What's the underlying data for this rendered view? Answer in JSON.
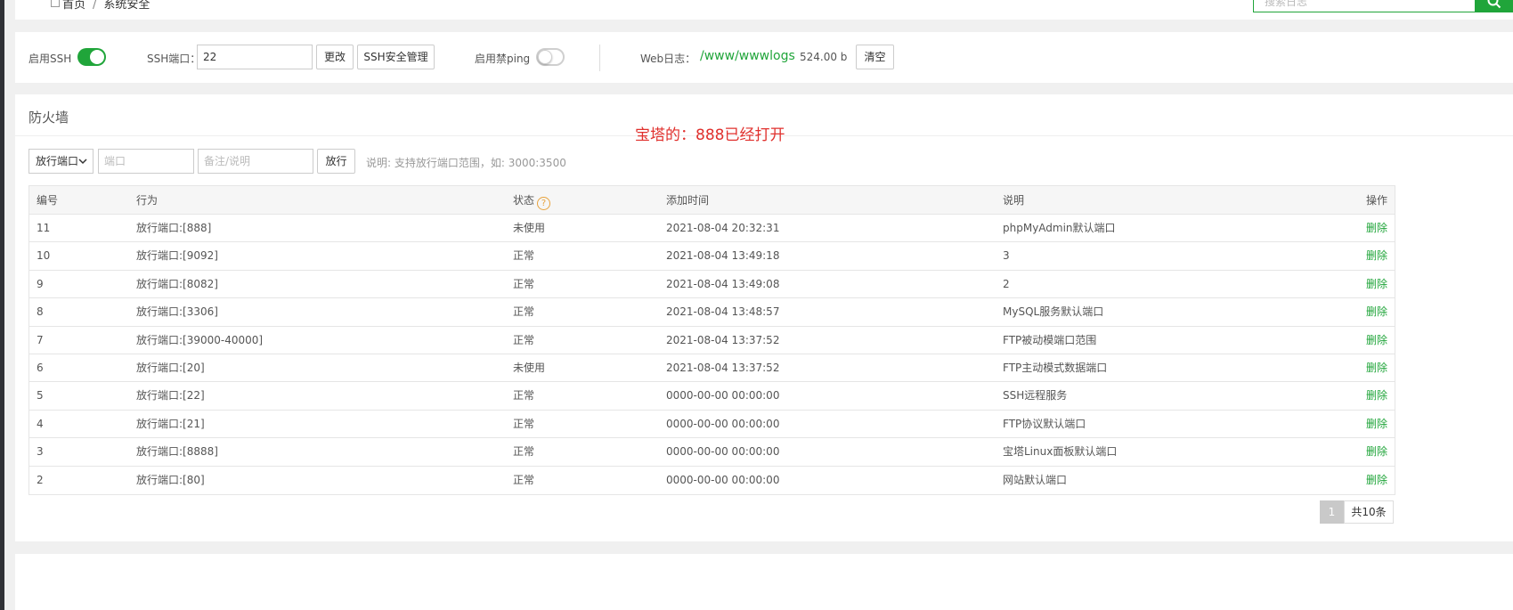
{
  "breadcrumb": {
    "home": "首页",
    "separator": "/",
    "current": "系统安全"
  },
  "search": {
    "placeholder": "搜索日志"
  },
  "ssh": {
    "enable_label": "启用SSH",
    "enabled": true,
    "port_label": "SSH端口：",
    "port_value": "22",
    "change_button": "更改",
    "manage_button": "SSH安全管理",
    "ping_label": "启用禁ping",
    "ping_enabled": false,
    "weblog_label": "Web日志：",
    "weblog_path": "/www/wwwlogs",
    "weblog_size": "524.00 b",
    "clear_button": "清空"
  },
  "firewall": {
    "title": "防火墙",
    "annotation": "宝塔的：888已经打开",
    "action_select": "放行端口",
    "port_placeholder": "端口",
    "remark_placeholder": "备注/说明",
    "add_button": "放行",
    "note": "说明: 支持放行端口范围，如: 3000:3500",
    "columns": [
      "编号",
      "行为",
      "状态",
      "添加时间",
      "说明",
      "操作"
    ],
    "rows": [
      {
        "id": "11",
        "action": "放行端口:[888]",
        "status": "未使用",
        "time": "2021-08-04 20:32:31",
        "desc": "phpMyAdmin默认端口",
        "op": "删除"
      },
      {
        "id": "10",
        "action": "放行端口:[9092]",
        "status": "正常",
        "time": "2021-08-04 13:49:18",
        "desc": "3",
        "op": "删除"
      },
      {
        "id": "9",
        "action": "放行端口:[8082]",
        "status": "正常",
        "time": "2021-08-04 13:49:08",
        "desc": "2",
        "op": "删除"
      },
      {
        "id": "8",
        "action": "放行端口:[3306]",
        "status": "正常",
        "time": "2021-08-04 13:48:57",
        "desc": "MySQL服务默认端口",
        "op": "删除"
      },
      {
        "id": "7",
        "action": "放行端口:[39000-40000]",
        "status": "正常",
        "time": "2021-08-04 13:37:52",
        "desc": "FTP被动模端口范围",
        "op": "删除"
      },
      {
        "id": "6",
        "action": "放行端口:[20]",
        "status": "未使用",
        "time": "2021-08-04 13:37:52",
        "desc": "FTP主动模式数据端口",
        "op": "删除"
      },
      {
        "id": "5",
        "action": "放行端口:[22]",
        "status": "正常",
        "time": "0000-00-00 00:00:00",
        "desc": "SSH远程服务",
        "op": "删除"
      },
      {
        "id": "4",
        "action": "放行端口:[21]",
        "status": "正常",
        "time": "0000-00-00 00:00:00",
        "desc": "FTP协议默认端口",
        "op": "删除"
      },
      {
        "id": "3",
        "action": "放行端口:[8888]",
        "status": "正常",
        "time": "0000-00-00 00:00:00",
        "desc": "宝塔Linux面板默认端口",
        "op": "删除"
      },
      {
        "id": "2",
        "action": "放行端口:[80]",
        "status": "正常",
        "time": "0000-00-00 00:00:00",
        "desc": "网站默认端口",
        "op": "删除"
      }
    ],
    "pagination": {
      "current": "1",
      "total": "共10条"
    }
  },
  "colors": {
    "accent": "#20a53a",
    "annotation": "#e0302d",
    "help": "#e8a33d"
  },
  "icons": [
    "home-icon",
    "search-icon",
    "help-icon",
    "chevron-down-icon"
  ]
}
